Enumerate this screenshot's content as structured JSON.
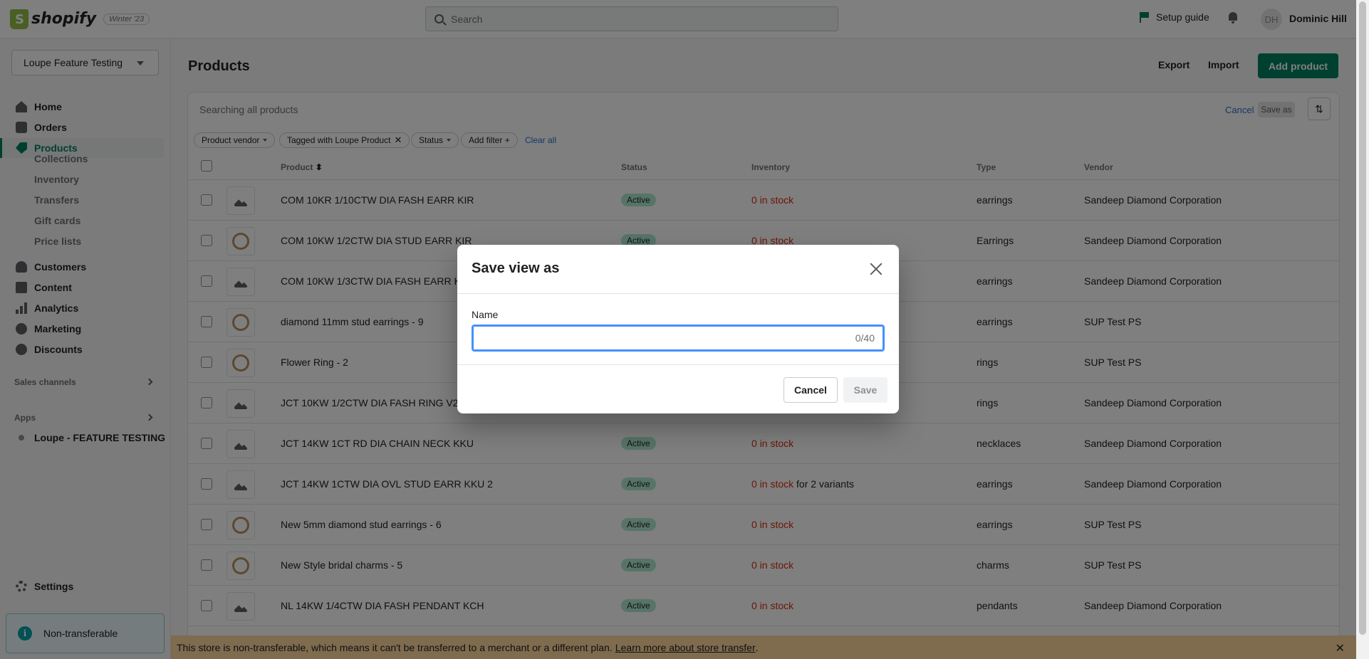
{
  "topbar": {
    "logo_text": "shopify",
    "edition_badge": "Winter '23",
    "search_placeholder": "Search",
    "setup_guide": "Setup guide",
    "avatar_initials": "DH",
    "user_name": "Dominic Hill"
  },
  "sidebar": {
    "store_name": "Loupe Feature Testing",
    "nav": {
      "home": "Home",
      "orders": "Orders",
      "products": "Products",
      "collections": "Collections",
      "inventory": "Inventory",
      "transfers": "Transfers",
      "gift_cards": "Gift cards",
      "price_lists": "Price lists",
      "customers": "Customers",
      "content": "Content",
      "analytics": "Analytics",
      "marketing": "Marketing",
      "discounts": "Discounts"
    },
    "sales_channels": "Sales channels",
    "apps": "Apps",
    "app_item": "Loupe - FEATURE TESTING",
    "settings": "Settings",
    "non_transferable": "Non-transferable"
  },
  "header": {
    "title": "Products",
    "export": "Export",
    "import": "Import",
    "add_product": "Add product"
  },
  "filters": {
    "search_text": "Searching all products",
    "cancel": "Cancel",
    "save_as": "Save as",
    "chips": {
      "vendor": "Product vendor",
      "tagged": "Tagged with Loupe Product",
      "status": "Status",
      "add_filter": "Add filter +"
    },
    "clear_all": "Clear all"
  },
  "table": {
    "columns": {
      "product": "Product",
      "status": "Status",
      "inventory": "Inventory",
      "type": "Type",
      "vendor": "Vendor"
    },
    "rows": [
      {
        "name": "COM 10KR 1/10CTW DIA FASH EARR KIR",
        "status": "Active",
        "inventory": "0 in stock",
        "inventory_suffix": "",
        "type": "earrings",
        "vendor": "Sandeep Diamond Corporation"
      },
      {
        "name": "COM 10KW 1/2CTW DIA STUD EARR KIR",
        "status": "Active",
        "inventory": "0 in stock",
        "inventory_suffix": "",
        "type": "Earrings",
        "vendor": "Sandeep Diamond Corporation"
      },
      {
        "name": "COM 10KW 1/3CTW DIA FASH EARR KIR",
        "status": "",
        "inventory": "",
        "inventory_suffix": "",
        "type": "earrings",
        "vendor": "Sandeep Diamond Corporation"
      },
      {
        "name": "diamond 11mm stud earrings - 9",
        "status": "",
        "inventory": "",
        "inventory_suffix": "",
        "type": "earrings",
        "vendor": "SUP Test PS"
      },
      {
        "name": "Flower Ring - 2",
        "status": "",
        "inventory": "",
        "inventory_suffix": "",
        "type": "rings",
        "vendor": "SUP Test PS"
      },
      {
        "name": "JCT 10KW 1/2CTW DIA FASH RING V2",
        "status": "",
        "inventory": "",
        "inventory_suffix": "",
        "type": "rings",
        "vendor": "Sandeep Diamond Corporation"
      },
      {
        "name": "JCT 14KW 1CT RD DIA CHAIN NECK KKU",
        "status": "Active",
        "inventory": "0 in stock",
        "inventory_suffix": "",
        "type": "necklaces",
        "vendor": "Sandeep Diamond Corporation"
      },
      {
        "name": "JCT 14KW 1CTW DIA OVL STUD EARR KKU 2",
        "status": "Active",
        "inventory": "0 in stock",
        "inventory_suffix": "for 2 variants",
        "type": "earrings",
        "vendor": "Sandeep Diamond Corporation"
      },
      {
        "name": "New 5mm diamond stud earrings - 6",
        "status": "Active",
        "inventory": "0 in stock",
        "inventory_suffix": "",
        "type": "earrings",
        "vendor": "SUP Test PS"
      },
      {
        "name": "New Style bridal charms - 5",
        "status": "Active",
        "inventory": "0 in stock",
        "inventory_suffix": "",
        "type": "charms",
        "vendor": "SUP Test PS"
      },
      {
        "name": "NL 14KW 1/4CTW DIA FASH PENDANT KCH",
        "status": "Active",
        "inventory": "0 in stock",
        "inventory_suffix": "",
        "type": "pendants",
        "vendor": "Sandeep Diamond Corporation"
      }
    ]
  },
  "banner": {
    "text": "This store is non-transferable, which means it can't be transferred to a merchant or a different plan.",
    "link": "Learn more about store transfer",
    "suffix": "."
  },
  "modal": {
    "title": "Save view as",
    "name_label": "Name",
    "name_value": "",
    "char_count": "0/40",
    "cancel": "Cancel",
    "save": "Save"
  },
  "colors": {
    "brand_green": "#008060",
    "link_blue": "#2c6ecb",
    "error_red": "#d72c0d",
    "active_badge": "#aee9d1"
  }
}
